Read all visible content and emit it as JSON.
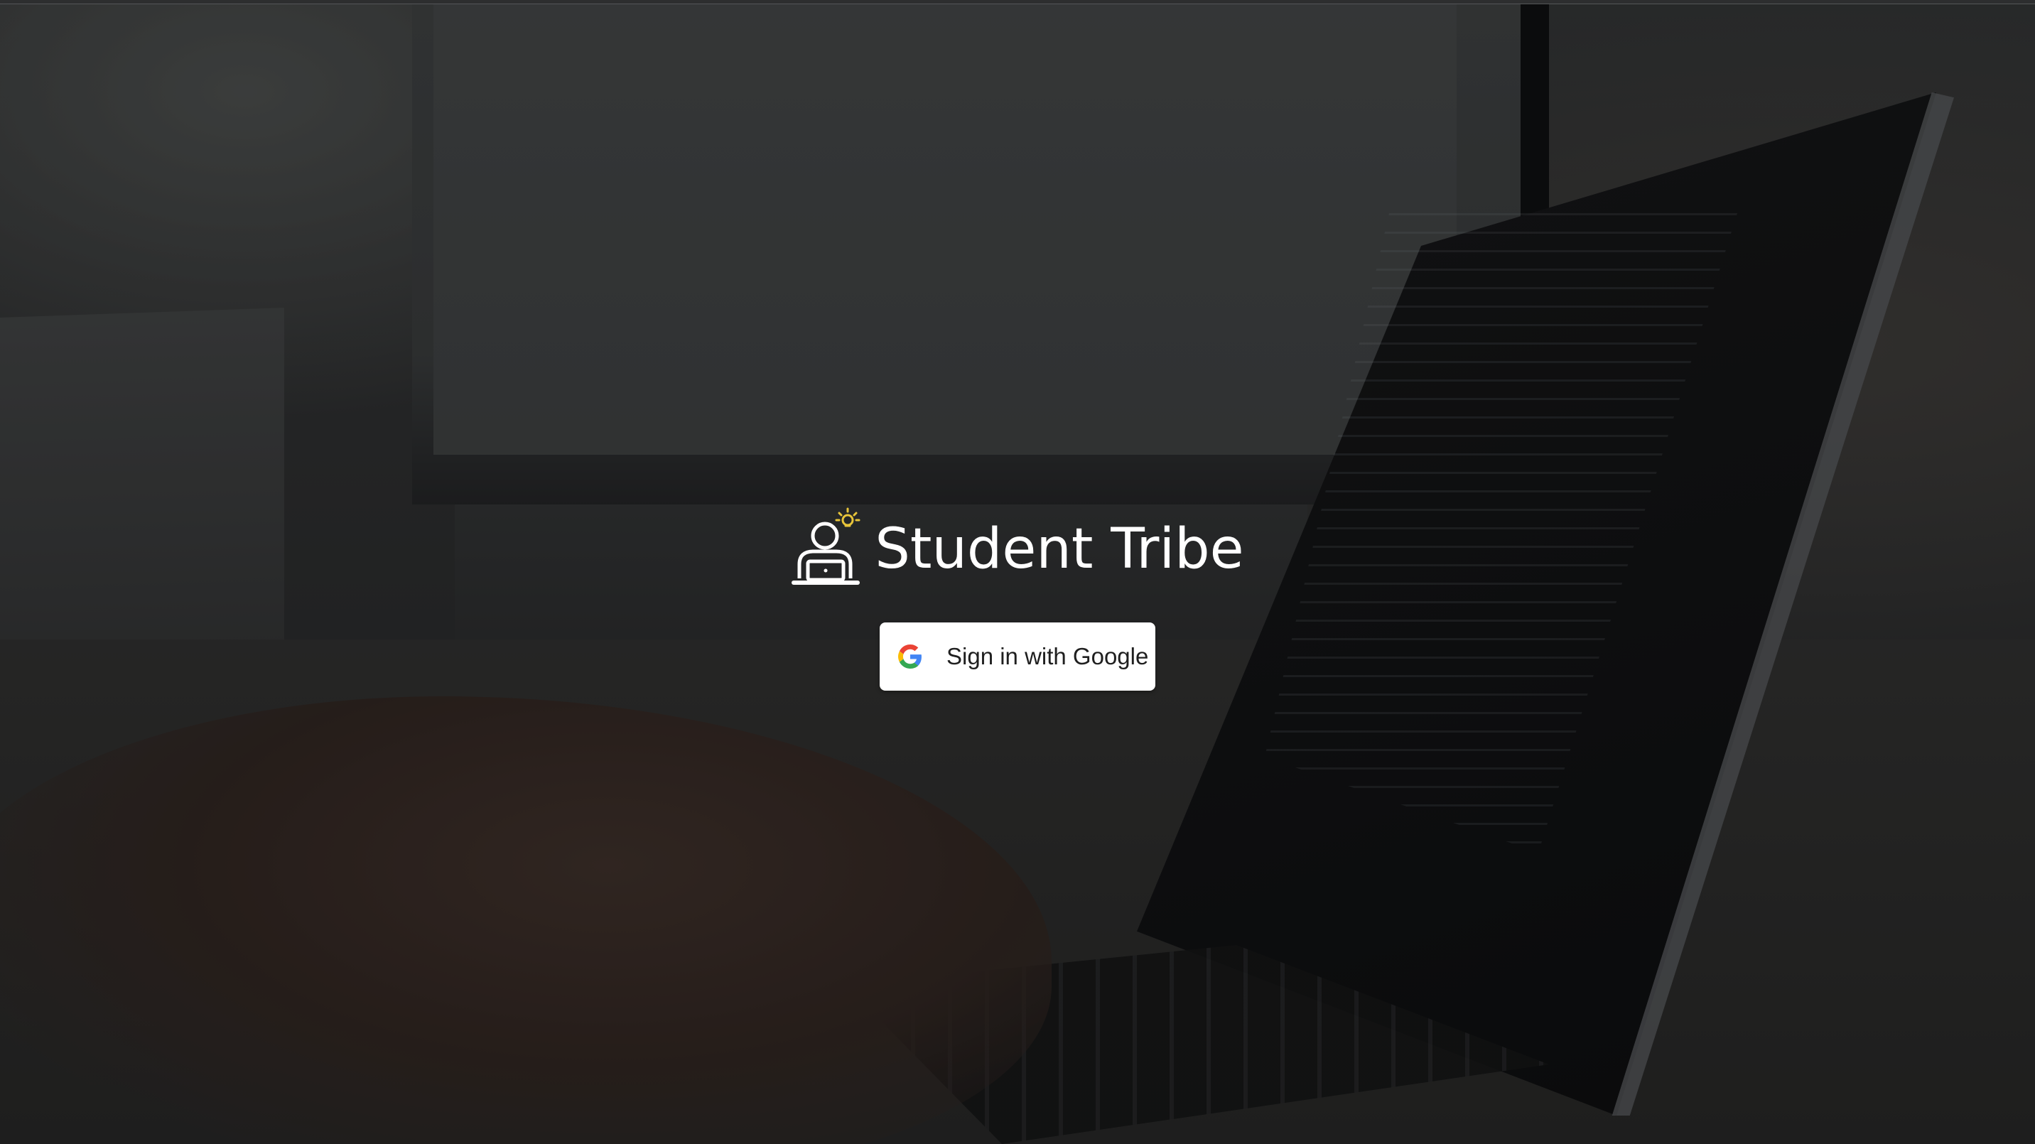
{
  "brand": {
    "name": "Student Tribe",
    "logo_icon": "student-laptop-lightbulb-icon"
  },
  "auth": {
    "google_button_label": "Sign in with Google",
    "provider_icon": "google-g-icon"
  },
  "colors": {
    "overlay": "#000000",
    "brand_text": "#ffffff",
    "button_bg": "#ffffff",
    "button_text": "#1f1f1f",
    "lightbulb": "#e8c53a"
  },
  "background": {
    "icon": "desk-laptop-photo"
  }
}
